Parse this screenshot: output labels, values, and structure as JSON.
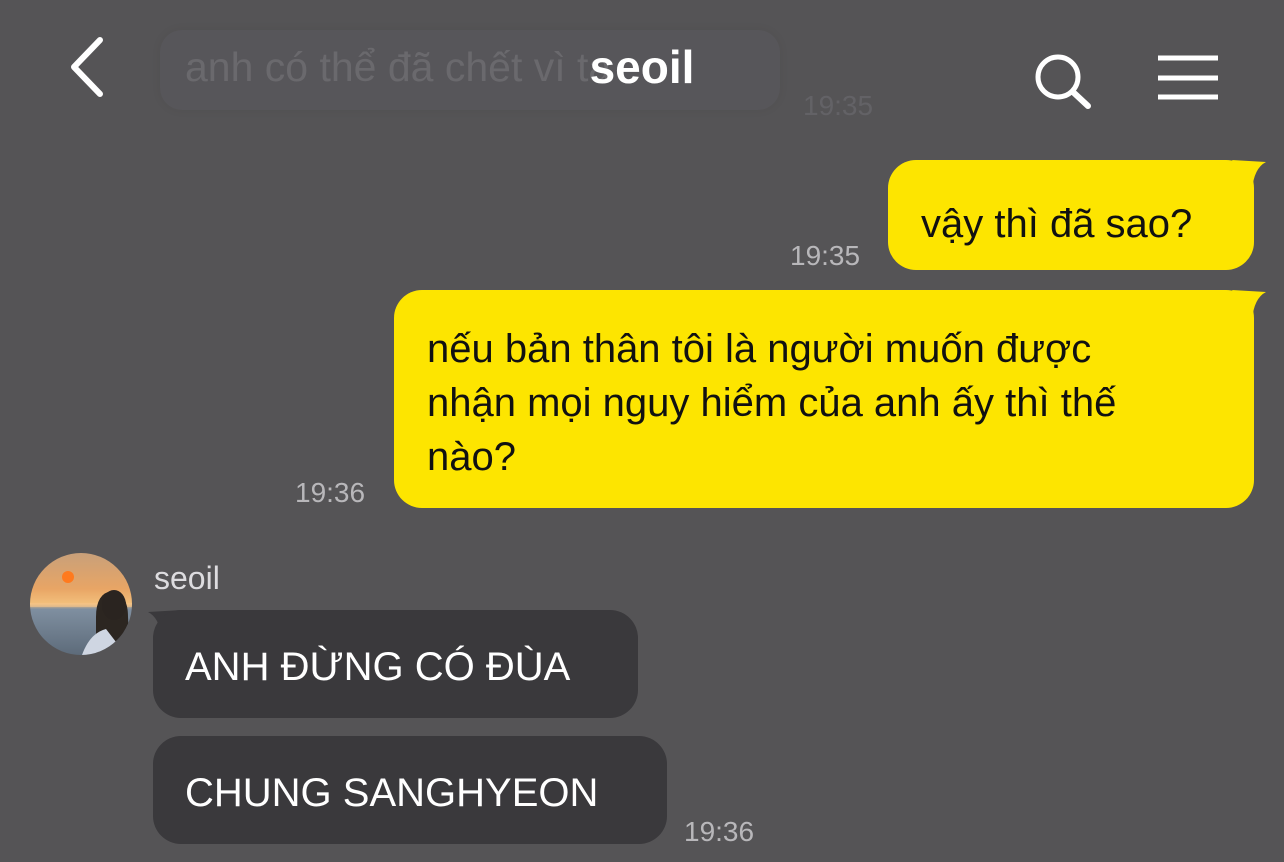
{
  "header": {
    "title": "seoil",
    "back_icon": "chevron-left-icon",
    "search_icon": "search-icon",
    "menu_icon": "hamburger-menu-icon"
  },
  "ghost_message": {
    "text": "anh có thể đã chết vì ta",
    "time": "19:35"
  },
  "messages": [
    {
      "side": "mine",
      "text": "vậy thì đã sao?",
      "time": "19:35"
    },
    {
      "side": "mine",
      "lines": [
        "nếu bản thân tôi là người muốn được",
        "nhận mọi nguy hiểm của anh ấy thì thế",
        "nào?"
      ],
      "time": "19:36"
    },
    {
      "side": "theirs",
      "sender": "seoil",
      "text": "ANH ĐỪNG CÓ ĐÙA"
    },
    {
      "side": "theirs",
      "text": "CHUNG SANGHYEON",
      "time": "19:36"
    }
  ],
  "colors": {
    "background": "#555456",
    "my_bubble": "#fde500",
    "their_bubble": "#3a393c",
    "timestamp": "#b8b7ba"
  }
}
